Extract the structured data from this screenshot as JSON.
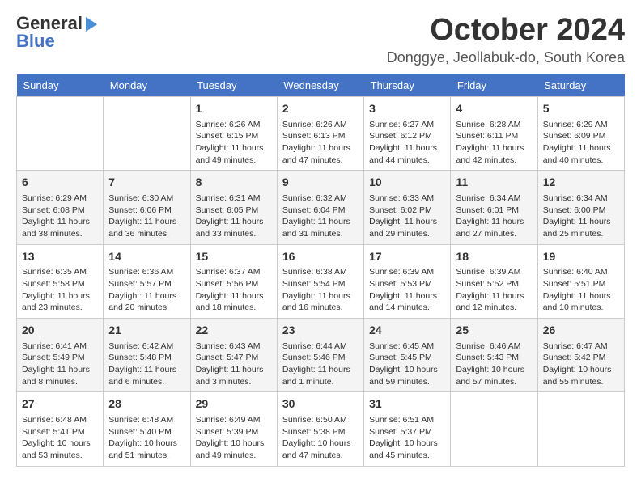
{
  "header": {
    "logo_line1": "General",
    "logo_line2": "Blue",
    "month": "October 2024",
    "location": "Donggye, Jeollabuk-do, South Korea"
  },
  "days_of_week": [
    "Sunday",
    "Monday",
    "Tuesday",
    "Wednesday",
    "Thursday",
    "Friday",
    "Saturday"
  ],
  "weeks": [
    [
      {
        "day": "",
        "info": ""
      },
      {
        "day": "",
        "info": ""
      },
      {
        "day": "1",
        "info": "Sunrise: 6:26 AM\nSunset: 6:15 PM\nDaylight: 11 hours and 49 minutes."
      },
      {
        "day": "2",
        "info": "Sunrise: 6:26 AM\nSunset: 6:13 PM\nDaylight: 11 hours and 47 minutes."
      },
      {
        "day": "3",
        "info": "Sunrise: 6:27 AM\nSunset: 6:12 PM\nDaylight: 11 hours and 44 minutes."
      },
      {
        "day": "4",
        "info": "Sunrise: 6:28 AM\nSunset: 6:11 PM\nDaylight: 11 hours and 42 minutes."
      },
      {
        "day": "5",
        "info": "Sunrise: 6:29 AM\nSunset: 6:09 PM\nDaylight: 11 hours and 40 minutes."
      }
    ],
    [
      {
        "day": "6",
        "info": "Sunrise: 6:29 AM\nSunset: 6:08 PM\nDaylight: 11 hours and 38 minutes."
      },
      {
        "day": "7",
        "info": "Sunrise: 6:30 AM\nSunset: 6:06 PM\nDaylight: 11 hours and 36 minutes."
      },
      {
        "day": "8",
        "info": "Sunrise: 6:31 AM\nSunset: 6:05 PM\nDaylight: 11 hours and 33 minutes."
      },
      {
        "day": "9",
        "info": "Sunrise: 6:32 AM\nSunset: 6:04 PM\nDaylight: 11 hours and 31 minutes."
      },
      {
        "day": "10",
        "info": "Sunrise: 6:33 AM\nSunset: 6:02 PM\nDaylight: 11 hours and 29 minutes."
      },
      {
        "day": "11",
        "info": "Sunrise: 6:34 AM\nSunset: 6:01 PM\nDaylight: 11 hours and 27 minutes."
      },
      {
        "day": "12",
        "info": "Sunrise: 6:34 AM\nSunset: 6:00 PM\nDaylight: 11 hours and 25 minutes."
      }
    ],
    [
      {
        "day": "13",
        "info": "Sunrise: 6:35 AM\nSunset: 5:58 PM\nDaylight: 11 hours and 23 minutes."
      },
      {
        "day": "14",
        "info": "Sunrise: 6:36 AM\nSunset: 5:57 PM\nDaylight: 11 hours and 20 minutes."
      },
      {
        "day": "15",
        "info": "Sunrise: 6:37 AM\nSunset: 5:56 PM\nDaylight: 11 hours and 18 minutes."
      },
      {
        "day": "16",
        "info": "Sunrise: 6:38 AM\nSunset: 5:54 PM\nDaylight: 11 hours and 16 minutes."
      },
      {
        "day": "17",
        "info": "Sunrise: 6:39 AM\nSunset: 5:53 PM\nDaylight: 11 hours and 14 minutes."
      },
      {
        "day": "18",
        "info": "Sunrise: 6:39 AM\nSunset: 5:52 PM\nDaylight: 11 hours and 12 minutes."
      },
      {
        "day": "19",
        "info": "Sunrise: 6:40 AM\nSunset: 5:51 PM\nDaylight: 11 hours and 10 minutes."
      }
    ],
    [
      {
        "day": "20",
        "info": "Sunrise: 6:41 AM\nSunset: 5:49 PM\nDaylight: 11 hours and 8 minutes."
      },
      {
        "day": "21",
        "info": "Sunrise: 6:42 AM\nSunset: 5:48 PM\nDaylight: 11 hours and 6 minutes."
      },
      {
        "day": "22",
        "info": "Sunrise: 6:43 AM\nSunset: 5:47 PM\nDaylight: 11 hours and 3 minutes."
      },
      {
        "day": "23",
        "info": "Sunrise: 6:44 AM\nSunset: 5:46 PM\nDaylight: 11 hours and 1 minute."
      },
      {
        "day": "24",
        "info": "Sunrise: 6:45 AM\nSunset: 5:45 PM\nDaylight: 10 hours and 59 minutes."
      },
      {
        "day": "25",
        "info": "Sunrise: 6:46 AM\nSunset: 5:43 PM\nDaylight: 10 hours and 57 minutes."
      },
      {
        "day": "26",
        "info": "Sunrise: 6:47 AM\nSunset: 5:42 PM\nDaylight: 10 hours and 55 minutes."
      }
    ],
    [
      {
        "day": "27",
        "info": "Sunrise: 6:48 AM\nSunset: 5:41 PM\nDaylight: 10 hours and 53 minutes."
      },
      {
        "day": "28",
        "info": "Sunrise: 6:48 AM\nSunset: 5:40 PM\nDaylight: 10 hours and 51 minutes."
      },
      {
        "day": "29",
        "info": "Sunrise: 6:49 AM\nSunset: 5:39 PM\nDaylight: 10 hours and 49 minutes."
      },
      {
        "day": "30",
        "info": "Sunrise: 6:50 AM\nSunset: 5:38 PM\nDaylight: 10 hours and 47 minutes."
      },
      {
        "day": "31",
        "info": "Sunrise: 6:51 AM\nSunset: 5:37 PM\nDaylight: 10 hours and 45 minutes."
      },
      {
        "day": "",
        "info": ""
      },
      {
        "day": "",
        "info": ""
      }
    ]
  ]
}
